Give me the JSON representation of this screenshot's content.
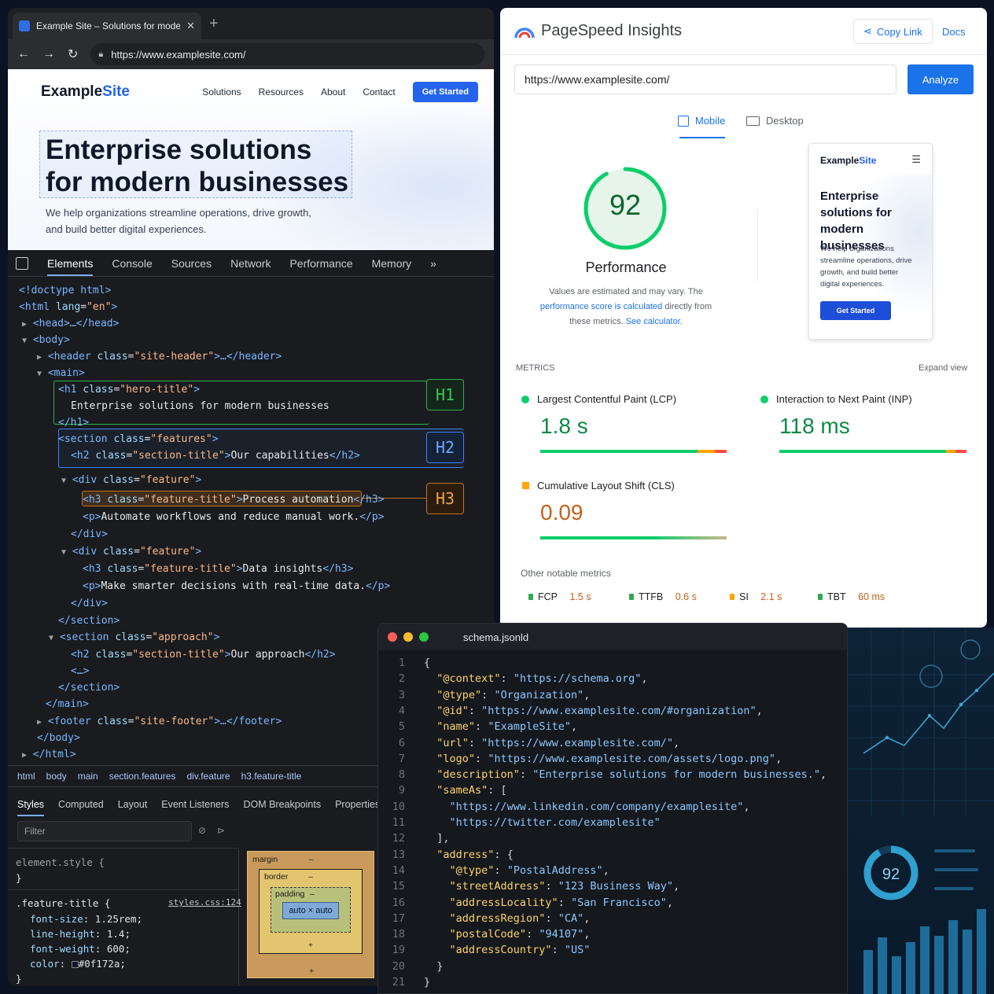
{
  "browser": {
    "tab_title": "Example Site – Solutions for modern businesses",
    "tab_close": "✕",
    "new_tab": "+",
    "url": "https://www.examplesite.com/",
    "site": {
      "brand_main": "Example",
      "brand_accent": "Site",
      "nav": [
        "Solutions",
        "Resources",
        "About",
        "Contact"
      ],
      "cta": "Get Started",
      "hero_title": "Enterprise solutions for modern businesses",
      "hero_subtitle": "We help organizations streamline operations, drive growth, and build better digital experiences."
    }
  },
  "devtools": {
    "tabs": [
      "Elements",
      "Console",
      "Sources",
      "Network",
      "Performance",
      "Memory",
      "»"
    ],
    "badges": {
      "h1": "H1",
      "h2": "H2",
      "h3": "H3"
    },
    "dom_texts": {
      "doctype": "<!doctype html>",
      "html_open_tag": "<html",
      "html_lang_attr": "lang",
      "html_lang_val": "\"en\"",
      "head": "<head>…</head>",
      "body_open": "<body>",
      "header_tag": "<header",
      "header_class": "\"site-header\"",
      "header_rest": ">…</header>",
      "main_open": "<main>",
      "h1_tag": "<h1",
      "h1_class": "\"hero-title\"",
      "h1_text": "Enterprise solutions for modern businesses",
      "h1_close": "</h1>",
      "section_tag": "<section",
      "features_class": "\"features\"",
      "h2_tag": "<h2",
      "section_title_class": "\"section-title\"",
      "h2_text_1": "Our capabilities",
      "h2_close": "</h2>",
      "div_tag": "<div",
      "feature_class": "\"feature\"",
      "h3_tag": "<h3",
      "feature_title_class": "\"feature-title\"",
      "h3_text_1": "Process automation",
      "h3_close": "</h3>",
      "p_open": "<p>",
      "p_text_1": "Automate workflows and reduce manual work.",
      "p_close": "</p>",
      "div_close": "</div>",
      "h3_text_2": "Data insights",
      "p_text_2": "Make smarter decisions with real-time data.",
      "section_close": "</section>",
      "approach_class": "\"approach\"",
      "h2_text_2": "Our approach",
      "ellipsis": "<…>",
      "main_close": "</main>",
      "footer_tag": "<footer",
      "footer_class": "\"site-footer\"",
      "footer_rest": ">…</footer>",
      "body_close": "</body>",
      "html_close": "</html>",
      "class_attr": "class",
      "gt": ">"
    },
    "breadcrumbs": [
      "html",
      "body",
      "main",
      "section.features",
      "div.feature",
      "h3.feature-title"
    ],
    "sub_tabs": [
      "Styles",
      "Computed",
      "Layout",
      "Event Listeners",
      "DOM Breakpoints",
      "Properties"
    ],
    "filter_placeholder": "Filter",
    "styles": {
      "element_style": "element.style {",
      "brace_close": "}",
      "selector": ".feature-title {",
      "source": "styles.css:124",
      "rules": [
        {
          "prop": "font-size",
          "value": "1.25rem;"
        },
        {
          "prop": "line-height",
          "value": "1.4;"
        },
        {
          "prop": "font-weight",
          "value": "600;"
        },
        {
          "prop": "color",
          "value": "#0f172a;"
        }
      ]
    },
    "box_model": {
      "margin": "margin",
      "border": "border",
      "padding": "padding",
      "content": "auto × auto",
      "dash": "–",
      "plus": "+"
    }
  },
  "pagespeed": {
    "title": "PageSpeed Insights",
    "copy_link": "Copy Link",
    "docs": "Docs",
    "url": "https://www.examplesite.com/",
    "analyze": "Analyze",
    "tab_mobile": "Mobile",
    "tab_desktop": "Desktop",
    "score": 92,
    "score_label": "Performance",
    "note_1": "Values are estimated and may vary. The",
    "note_link_1": "performance score is calculated",
    "note_2": " directly from",
    "note_3": "these metrics. ",
    "note_link_2": "See calculator.",
    "preview": {
      "brand_main": "Example",
      "brand_accent": "Site",
      "menu": "☰",
      "title": "Enterprise solutions for modern businesses",
      "text": "We help organizations streamline operations, drive growth, and build better digital experiences.",
      "cta": "Get Started"
    },
    "metrics_heading": "METRICS",
    "expand_view": "Expand view",
    "lcp_label": "Largest Contentful Paint (LCP)",
    "lcp_value": "1.8 s",
    "inp_label": "Interaction to Next Paint (INP)",
    "inp_value": "118 ms",
    "cls_label": "Cumulative Layout Shift (CLS)",
    "cls_value": "0.09",
    "other_heading": "Other notable metrics",
    "other": [
      {
        "name": "FCP",
        "value": "1.5 s"
      },
      {
        "name": "TTFB",
        "value": "0.6 s"
      },
      {
        "name": "SI",
        "value": "2.1 s"
      },
      {
        "name": "TBT",
        "value": "60 ms"
      }
    ],
    "colors": {
      "good": "#0cce6b",
      "average": "#ffa400",
      "poor": "#ff4e42",
      "link": "#1a73e8"
    }
  },
  "editor": {
    "filename": "schema.jsonld",
    "lines": [
      [
        [
          "p",
          "{"
        ]
      ],
      [
        [
          "p",
          "  "
        ],
        [
          "k",
          "\"@context\""
        ],
        [
          "p",
          ": "
        ],
        [
          "s",
          "\"https://schema.org\""
        ],
        [
          "p",
          ","
        ]
      ],
      [
        [
          "p",
          "  "
        ],
        [
          "k",
          "\"@type\""
        ],
        [
          "p",
          ": "
        ],
        [
          "s",
          "\"Organization\""
        ],
        [
          "p",
          ","
        ]
      ],
      [
        [
          "p",
          "  "
        ],
        [
          "k",
          "\"@id\""
        ],
        [
          "p",
          ": "
        ],
        [
          "s",
          "\"https://www.examplesite.com/#organization\""
        ],
        [
          "p",
          ","
        ]
      ],
      [
        [
          "p",
          "  "
        ],
        [
          "k",
          "\"name\""
        ],
        [
          "p",
          ": "
        ],
        [
          "s",
          "\"ExampleSite\""
        ],
        [
          "p",
          ","
        ]
      ],
      [
        [
          "p",
          "  "
        ],
        [
          "k",
          "\"url\""
        ],
        [
          "p",
          ": "
        ],
        [
          "s",
          "\"https://www.examplesite.com/\""
        ],
        [
          "p",
          ","
        ]
      ],
      [
        [
          "p",
          "  "
        ],
        [
          "k",
          "\"logo\""
        ],
        [
          "p",
          ": "
        ],
        [
          "s",
          "\"https://www.examplesite.com/assets/logo.png\""
        ],
        [
          "p",
          ","
        ]
      ],
      [
        [
          "p",
          "  "
        ],
        [
          "k",
          "\"description\""
        ],
        [
          "p",
          ": "
        ],
        [
          "s",
          "\"Enterprise solutions for modern businesses.\""
        ],
        [
          "p",
          ","
        ]
      ],
      [
        [
          "p",
          "  "
        ],
        [
          "k",
          "\"sameAs\""
        ],
        [
          "p",
          ": ["
        ]
      ],
      [
        [
          "p",
          "    "
        ],
        [
          "s",
          "\"https://www.linkedin.com/company/examplesite\""
        ],
        [
          "p",
          ","
        ]
      ],
      [
        [
          "p",
          "    "
        ],
        [
          "s",
          "\"https://twitter.com/examplesite\""
        ]
      ],
      [
        [
          "p",
          "  ],"
        ]
      ],
      [
        [
          "p",
          "  "
        ],
        [
          "k",
          "\"address\""
        ],
        [
          "p",
          ": {"
        ]
      ],
      [
        [
          "p",
          "    "
        ],
        [
          "k",
          "\"@type\""
        ],
        [
          "p",
          ": "
        ],
        [
          "s",
          "\"PostalAddress\""
        ],
        [
          "p",
          ","
        ]
      ],
      [
        [
          "p",
          "    "
        ],
        [
          "k",
          "\"streetAddress\""
        ],
        [
          "p",
          ": "
        ],
        [
          "s",
          "\"123 Business Way\""
        ],
        [
          "p",
          ","
        ]
      ],
      [
        [
          "p",
          "    "
        ],
        [
          "k",
          "\"addressLocality\""
        ],
        [
          "p",
          ": "
        ],
        [
          "s",
          "\"San Francisco\""
        ],
        [
          "p",
          ","
        ]
      ],
      [
        [
          "p",
          "    "
        ],
        [
          "k",
          "\"addressRegion\""
        ],
        [
          "p",
          ": "
        ],
        [
          "s",
          "\"CA\""
        ],
        [
          "p",
          ","
        ]
      ],
      [
        [
          "p",
          "    "
        ],
        [
          "k",
          "\"postalCode\""
        ],
        [
          "p",
          ": "
        ],
        [
          "s",
          "\"94107\""
        ],
        [
          "p",
          ","
        ]
      ],
      [
        [
          "p",
          "    "
        ],
        [
          "k",
          "\"addressCountry\""
        ],
        [
          "p",
          ": "
        ],
        [
          "s",
          "\"US\""
        ]
      ],
      [
        [
          "p",
          "  }"
        ]
      ],
      [
        [
          "p",
          "}"
        ]
      ]
    ]
  },
  "dashboard": {
    "score": "92"
  }
}
